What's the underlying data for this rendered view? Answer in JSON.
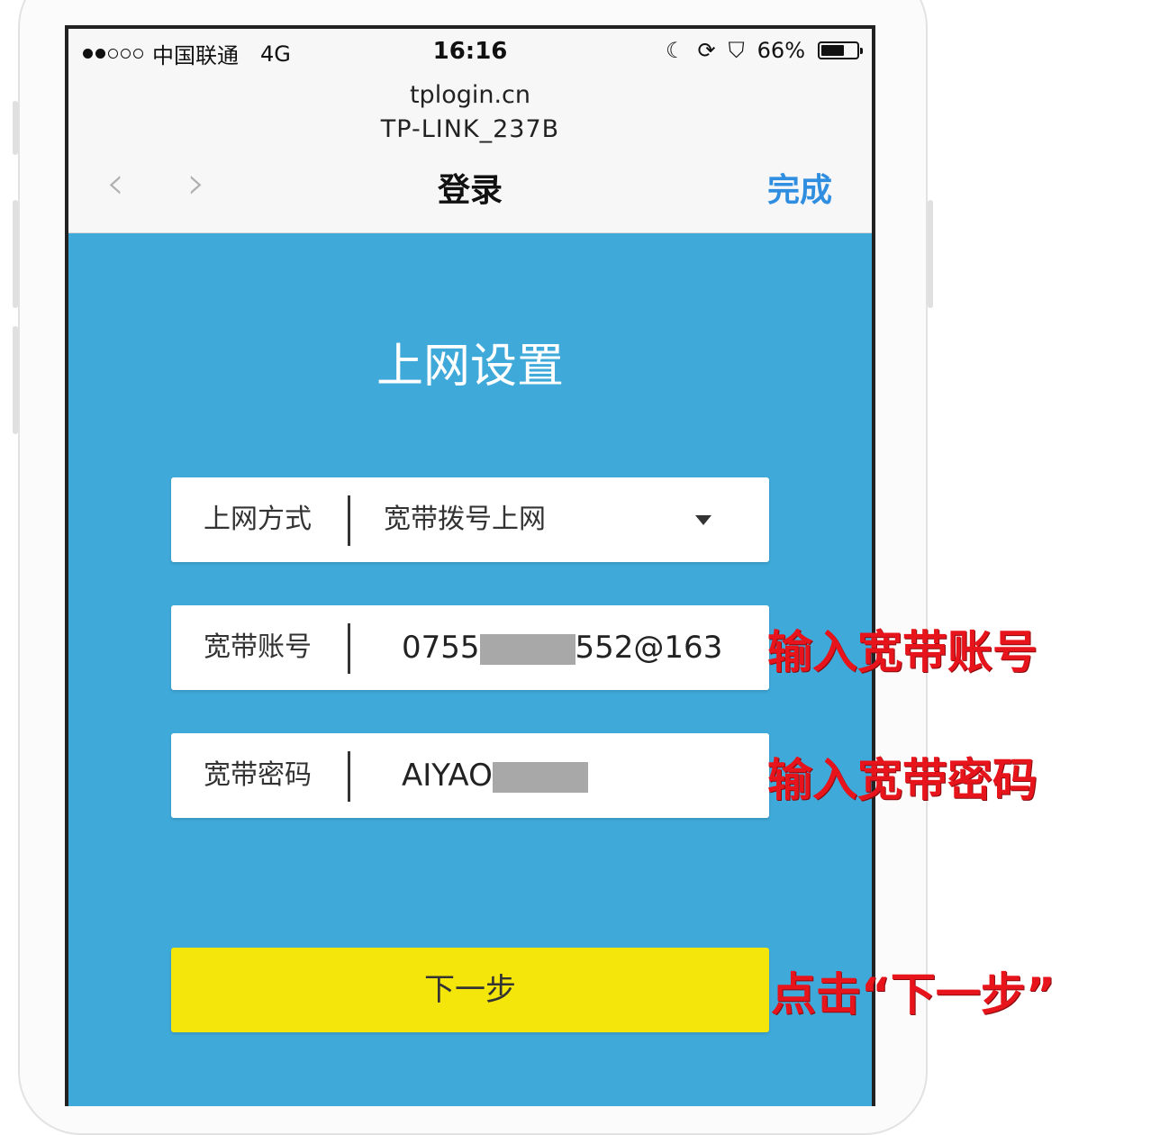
{
  "status_bar": {
    "carrier": "中国联通",
    "network": "4G",
    "time": "16:16",
    "battery": "66%",
    "battery_level": 0.66
  },
  "browser": {
    "url": "tplogin.cn",
    "ssid": "TP-LINK_237B",
    "title": "登录",
    "done_label": "完成"
  },
  "page": {
    "title": "上网设置",
    "fields": [
      {
        "label": "上网方式",
        "value": "宽带拨号上网"
      },
      {
        "label": "宽带账号",
        "value_prefix": "0755",
        "value_suffix": "552@163"
      },
      {
        "label": "宽带密码",
        "value_prefix": "AIYAO"
      }
    ],
    "next_label": "下一步"
  },
  "annotations": {
    "account": "输入宽带账号",
    "password": "输入宽带密码",
    "next": "点击“下一步”"
  },
  "colors": {
    "page_bg": "#3fa9d9",
    "button": "#f4e60a",
    "accent": "#2f8ee0",
    "annotation": "#e8141c"
  }
}
